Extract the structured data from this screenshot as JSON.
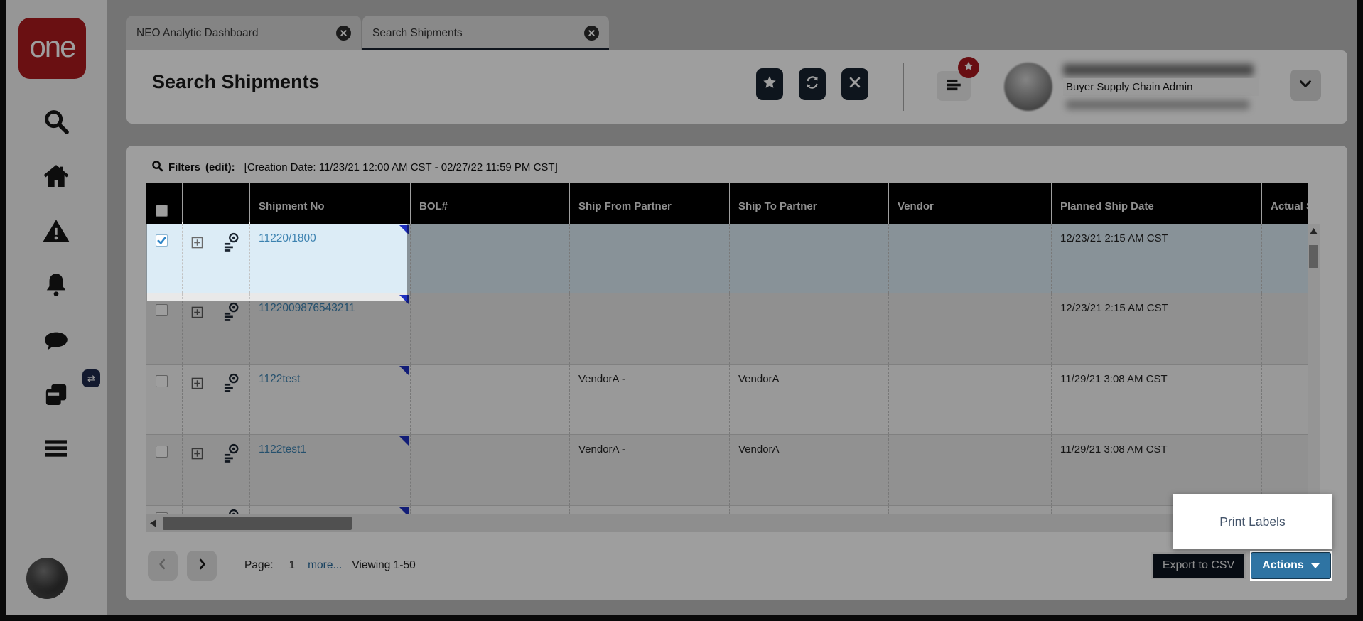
{
  "logo": {
    "text": "one"
  },
  "tabs": [
    {
      "label": "NEO Analytic Dashboard"
    },
    {
      "label": "Search Shipments"
    }
  ],
  "page": {
    "title": "Search Shipments"
  },
  "user": {
    "role": "Buyer Supply Chain Admin"
  },
  "filters": {
    "label": "Filters",
    "edit": "(edit):",
    "value": "[Creation Date: 11/23/21 12:00 AM CST - 02/27/22 11:59 PM CST]"
  },
  "grid": {
    "columns": [
      "Shipment No",
      "BOL#",
      "Ship From Partner",
      "Ship To Partner",
      "Vendor",
      "Planned Ship Date",
      "Actual Sh"
    ],
    "rows": [
      {
        "shipment_no": "11220/1800",
        "bol": "",
        "ship_from": "",
        "ship_to": "",
        "vendor": "",
        "planned_ship_date": "12/23/21 2:15 AM CST",
        "selected": true
      },
      {
        "shipment_no": "1122009876543211",
        "bol": "",
        "ship_from": "",
        "ship_to": "",
        "vendor": "",
        "planned_ship_date": "12/23/21 2:15 AM CST",
        "selected": false
      },
      {
        "shipment_no": "1122test",
        "bol": "",
        "ship_from": "VendorA -",
        "ship_to": "VendorA",
        "vendor": "",
        "planned_ship_date": "11/29/21 3:08 AM CST",
        "selected": false
      },
      {
        "shipment_no": "1122test1",
        "bol": "",
        "ship_from": "VendorA -",
        "ship_to": "VendorA",
        "vendor": "",
        "planned_ship_date": "11/29/21 3:08 AM CST",
        "selected": false
      }
    ]
  },
  "pagination": {
    "page_label": "Page:",
    "page": "1",
    "more": "more...",
    "viewing": "Viewing 1-50"
  },
  "footer": {
    "export_label": "Export to CSV",
    "actions_label": "Actions"
  },
  "popup": {
    "print_labels": "Print Labels"
  },
  "icons": {
    "transfer_glyph": "⇄",
    "star_glyph": "★"
  },
  "colors": {
    "brand_red": "#ab1b1e",
    "accent_blue": "#2f74a3",
    "selected_row": "#dcecf6",
    "link_blue": "#3c82b0",
    "corner_triangle": "#1e30c0",
    "grid_header": "#000000"
  }
}
